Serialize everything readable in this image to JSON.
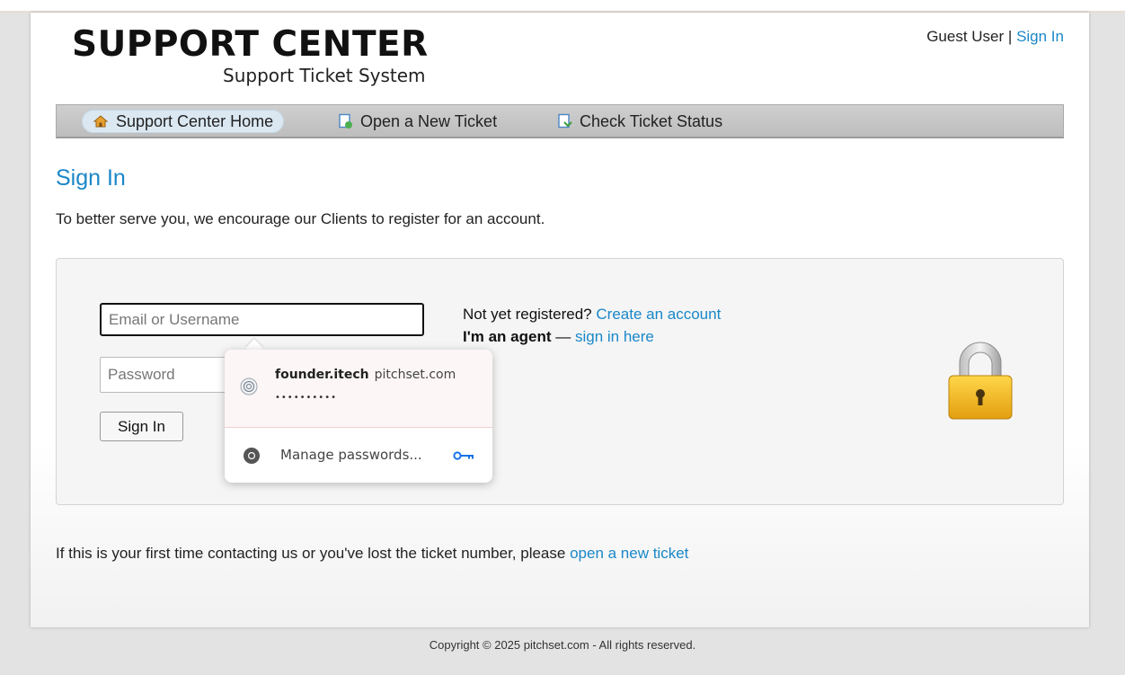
{
  "header": {
    "logo_title": "SUPPORT CENTER",
    "logo_subtitle": "Support Ticket System",
    "user_label": "Guest User",
    "separator": "|",
    "signin_link": "Sign In"
  },
  "nav": {
    "items": [
      {
        "label": "Support Center Home",
        "icon": "home-icon",
        "active": true
      },
      {
        "label": "Open a New Ticket",
        "icon": "new-ticket-icon",
        "active": false
      },
      {
        "label": "Check Ticket Status",
        "icon": "ticket-status-icon",
        "active": false
      }
    ]
  },
  "main": {
    "title": "Sign In",
    "intro": "To better serve you, we encourage our Clients to register for an account.",
    "form": {
      "username_placeholder": "Email or Username",
      "password_placeholder": "Password",
      "submit_label": "Sign In"
    },
    "register_prefix": "Not yet registered?",
    "register_link": "Create an account",
    "agent_prefix": "I'm an agent",
    "agent_dash": "—",
    "agent_link": "sign in here",
    "footer_prefix": "If this is your first time contacting us or you've lost the ticket number, please",
    "footer_link": "open a new ticket"
  },
  "password_popup": {
    "username": "founder.itech",
    "site": "pitchset.com",
    "masked_password": "••••••••••",
    "manage_label": "Manage passwords..."
  },
  "footer": {
    "copyright": "Copyright © 2025 pitchset.com - All rights reserved."
  },
  "colors": {
    "link": "#1a87c8",
    "nav_bg": "#c6c6c6",
    "lock_gold": "#f2b91c"
  }
}
